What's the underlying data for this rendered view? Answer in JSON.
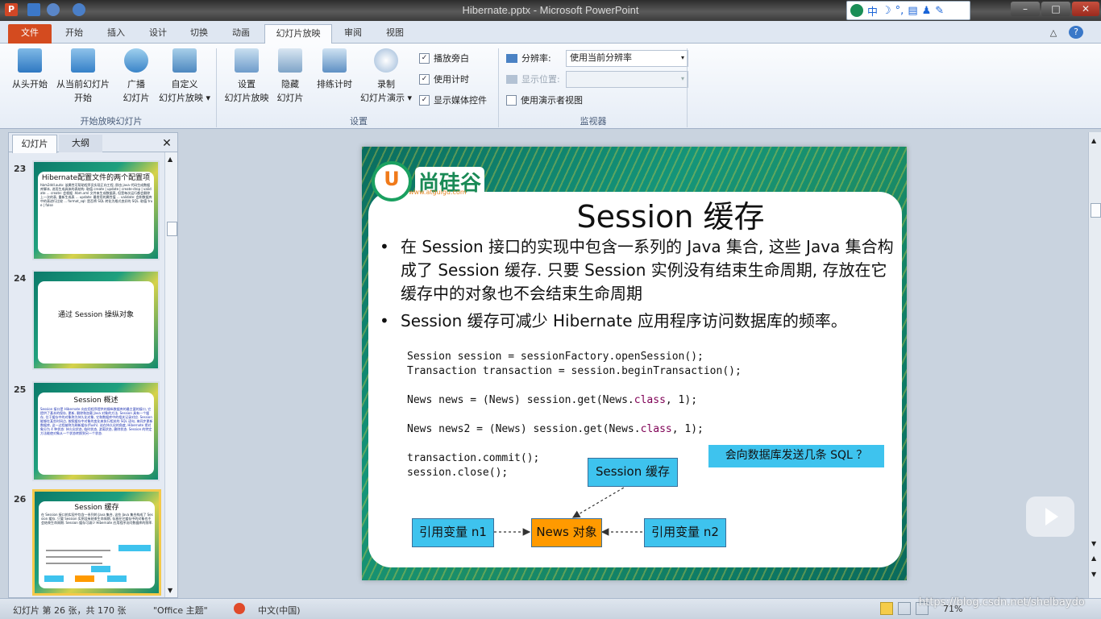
{
  "window": {
    "title": "Hibernate.pptx - Microsoft PowerPoint",
    "ime_label": "中"
  },
  "tabs": [
    {
      "label": "文件"
    },
    {
      "label": "开始"
    },
    {
      "label": "插入"
    },
    {
      "label": "设计"
    },
    {
      "label": "切换"
    },
    {
      "label": "动画"
    },
    {
      "label": "幻灯片放映"
    },
    {
      "label": "审阅"
    },
    {
      "label": "视图"
    }
  ],
  "ribbon": {
    "start_group": {
      "label": "开始放映幻灯片",
      "from_beginning": "从头开始",
      "from_current_1": "从当前幻灯片",
      "from_current_2": "开始",
      "broadcast_1": "广播",
      "broadcast_2": "幻灯片",
      "custom_1": "自定义",
      "custom_2": "幻灯片放映 ▾"
    },
    "setup_group": {
      "label": "设置",
      "setup_1": "设置",
      "setup_2": "幻灯片放映",
      "hide_1": "隐藏",
      "hide_2": "幻灯片",
      "rehearse": "排练计时",
      "record_1": "录制",
      "record_2": "幻灯片演示 ▾",
      "play_narrations": "播放旁白",
      "use_timings": "使用计时",
      "show_media_controls": "显示媒体控件"
    },
    "monitors_group": {
      "label": "监视器",
      "resolution_label": "分辨率:",
      "resolution_value": "使用当前分辨率",
      "show_on_label": "显示位置:",
      "presenter_view": "使用演示者视图"
    }
  },
  "left_pane": {
    "tab_slides": "幻灯片",
    "tab_outline": "大纲",
    "thumbnails": [
      {
        "num": "23",
        "title": "Hibernate配置文件的两个配置项",
        "body": "hbm2ddl.auto: 该属性可帮助程序员实现正向工程, 即由 java 代码生成数据库脚本, 进而生成具体的表结构. 取值 create | update | create-drop | validate ... create: 会根据 .hbm.xml 文件来生成数据表, 但是每次运行都会删除上一次的表, 重新生成表 ... update: 最常用的属性值 ... validate: 会和数据库中的表进行比较 ... format_sql: 是否将 SQL 转化为格式良好的 SQL. 取值 true | false"
      },
      {
        "num": "24",
        "title": "通过 Session 操纵对象",
        "body": ""
      },
      {
        "num": "25",
        "title": "Session 概述",
        "body": "Session 接口是 Hibernate 向应用程序提供的操纵数据库的最主要的接口, 它提供了基本的保存, 更新, 删除和加载 Java 对象的方法. Session 具有一个缓存, 位于缓存中的对象称为持久化对象, 它和数据库中的相关记录对应. Session 能够在某些时间点, 按照缓存中对象的变化来执行相关的 SQL 语句, 来同步更新数据库, 这一过程被称为刷新缓存(flush). 站在持久化的角度, Hibernate 把对象分为 4 种状态: 持久化状态, 临时状态, 游离状态, 删除状态. Session 的特定方法能使对象从一个状态转换到另一个状态."
      },
      {
        "num": "26",
        "title": "Session 缓存",
        "body": "在 Session 接口的实现中包含一系列的 Java 集合, 这些 Java 集合构成了 Session 缓存. 只要 Session 实例没有结束生命周期, 存放在它缓存中的对象也不会结束生命周期. Session 缓存可减少 Hibernate 应用程序访问数据库的频率."
      }
    ]
  },
  "slide": {
    "logo_text": "尚硅谷",
    "logo_letter": "U",
    "logo_url": "www.atguigu.com",
    "title": "Session 缓存",
    "bullets": [
      "在 Session 接口的实现中包含一系列的 Java 集合, 这些 Java 集合构成了 Session 缓存. 只要 Session 实例没有结束生命周期, 存放在它缓存中的对象也不会结束生命周期",
      "Session 缓存可减少 Hibernate 应用程序访问数据库的频率。"
    ],
    "code": {
      "line1": "Session session = sessionFactory.openSession();",
      "line2": "Transaction transaction = session.beginTransaction();",
      "line3a": "News news = (News) session.get(News.",
      "line3kw": "class",
      "line3b": ", 1);",
      "line4a": "News news2 = (News) session.get(News.",
      "line4kw": "class",
      "line4b": ", 1);",
      "line5": "transaction.commit();",
      "line6": "session.close();"
    },
    "question": "会向数据库发送几条 SQL ？",
    "diagram": {
      "cache_box": "Session 缓存",
      "ref1": "引用变量 n1",
      "news_obj": "News 对象",
      "ref2": "引用变量 n2",
      "cache_color": "#3ec3ee",
      "news_color": "#ff9a00"
    }
  },
  "status_bar": {
    "slide_info": "幻灯片 第 26 张，共 170 张",
    "theme": "\"Office 主题\"",
    "language": "中文(中国)",
    "zoom": "71%"
  },
  "watermark": "https://blog.csdn.net/shelbaydo"
}
